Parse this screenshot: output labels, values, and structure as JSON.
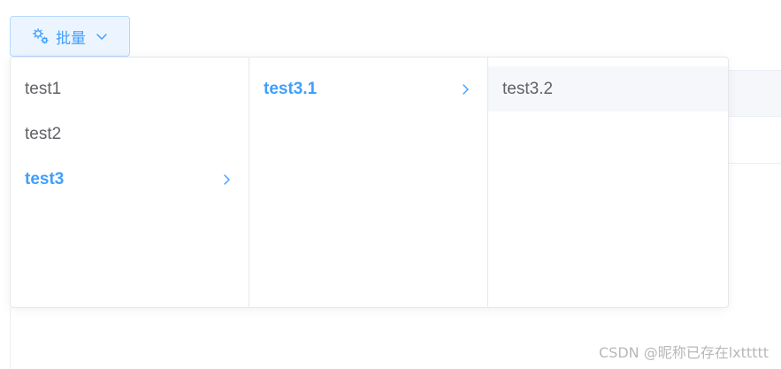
{
  "batch_button": {
    "label": "批量",
    "icon": "gears-icon",
    "dropdown_icon": "chevron-down-icon"
  },
  "cascader": {
    "columns": [
      {
        "items": [
          {
            "label": "test1",
            "active": false,
            "has_children": false
          },
          {
            "label": "test2",
            "active": false,
            "has_children": false
          },
          {
            "label": "test3",
            "active": true,
            "has_children": true
          }
        ]
      },
      {
        "items": [
          {
            "label": "test3.1",
            "active": true,
            "has_children": true
          }
        ]
      },
      {
        "items": [
          {
            "label": "test3.2",
            "active": false,
            "has_children": false,
            "hovered": true
          }
        ]
      }
    ]
  },
  "watermark": "CSDN @昵称已存在lxttttt",
  "colors": {
    "primary": "#409eff",
    "text": "#606266",
    "border": "#e4e7ed",
    "button_bg": "#ecf5ff",
    "button_border": "#b3d8ff",
    "hover_bg": "#f5f7fa"
  }
}
